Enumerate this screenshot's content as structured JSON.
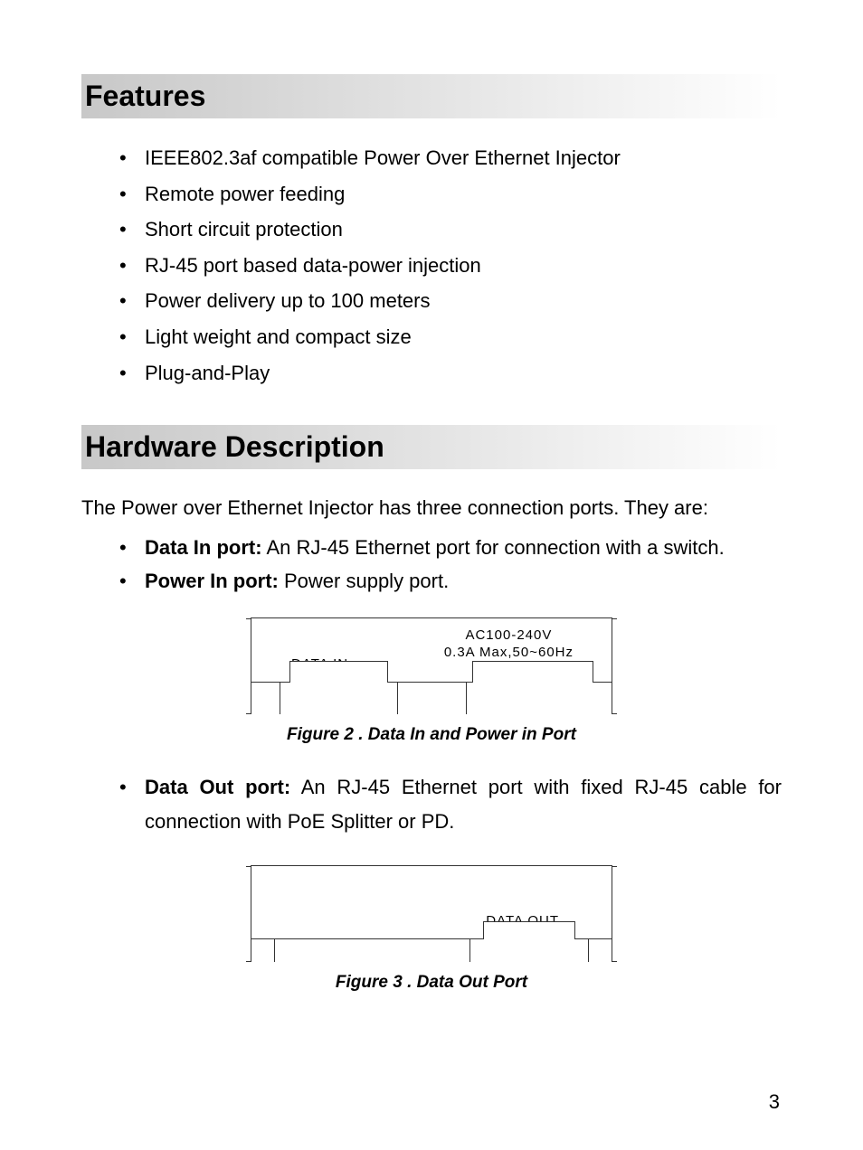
{
  "sections": {
    "features_heading": "Features",
    "hardware_heading": "Hardware Description"
  },
  "features": [
    "IEEE802.3af compatible Power Over Ethernet Injector",
    "Remote power feeding",
    "Short circuit protection",
    "RJ-45 port based data-power injection",
    "Power delivery up to 100 meters",
    "Light weight and compact size",
    "Plug-and-Play"
  ],
  "hardware_intro": "The Power over Ethernet Injector has three connection ports. They are:",
  "ports": {
    "data_in_label": "Data In port:",
    "data_in_desc": " An RJ-45 Ethernet port for connection with a switch.",
    "power_in_label": "Power In port:",
    "power_in_desc": " Power supply port.",
    "data_out_label": "Data Out port:",
    "data_out_desc": " An RJ-45 Ethernet port with fixed RJ-45 cable for connection with PoE Splitter or PD."
  },
  "figure2": {
    "power_spec_line1": "AC100-240V",
    "power_spec_line2": "0.3A Max,50~60Hz",
    "data_in_text": "DATA IN",
    "caption": "Figure 2 . Data In and Power in Port"
  },
  "figure3": {
    "data_out_text": "DATA OUT",
    "caption": "Figure 3 . Data Out Port"
  },
  "page_number": "3"
}
